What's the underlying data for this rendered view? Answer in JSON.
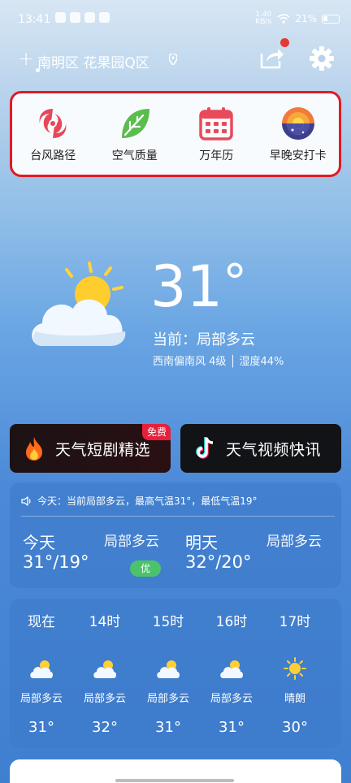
{
  "status": {
    "time": "13:41",
    "network_speed": "1.40 KB/s",
    "battery": "21%"
  },
  "location": {
    "name": "南明区 花果园Q区",
    "add_icon": "plus-icon",
    "pin_icon": "location-pin-icon"
  },
  "header_actions": {
    "share_icon": "share-icon",
    "settings_icon": "gear-icon"
  },
  "quick_actions": [
    {
      "label": "台风路径",
      "icon": "typhoon-icon"
    },
    {
      "label": "空气质量",
      "icon": "leaf-icon"
    },
    {
      "label": "万年历",
      "icon": "calendar-icon"
    },
    {
      "label": "早晚安打卡",
      "icon": "sun-moon-icon"
    }
  ],
  "current": {
    "temp": "31",
    "degree": "°",
    "condition": "当前：局部多云",
    "wind_humidity": "西南偏南风 4级 │ 湿度44%",
    "icon": "partly-cloudy-icon"
  },
  "banners": [
    {
      "label": "天气短剧精选",
      "badge": "免费",
      "icon": "flame-icon"
    },
    {
      "label": "天气视频快讯",
      "icon": "tiktok-icon"
    }
  ],
  "forecast": {
    "summary": "今天：当前局部多云，最高气温31°，最低气温19°",
    "today": {
      "name": "今天",
      "range": "31°/19°",
      "condition": "局部多云",
      "aqi": "优"
    },
    "tomorrow": {
      "name": "明天",
      "range": "32°/20°",
      "condition": "局部多云"
    }
  },
  "hourly": [
    {
      "time": "现在",
      "condition": "局部多云",
      "temp": "31°",
      "icon": "partly-cloudy-icon"
    },
    {
      "time": "14时",
      "condition": "局部多云",
      "temp": "32°",
      "icon": "partly-cloudy-icon"
    },
    {
      "time": "15时",
      "condition": "局部多云",
      "temp": "31°",
      "icon": "partly-cloudy-icon"
    },
    {
      "time": "16时",
      "condition": "局部多云",
      "temp": "31°",
      "icon": "partly-cloudy-icon"
    },
    {
      "time": "17时",
      "condition": "晴朗",
      "temp": "30°",
      "icon": "sun-icon"
    }
  ],
  "colors": {
    "highlight_border": "#e01b24",
    "aqi_good": "#4cc36b",
    "badge_red": "#e8213a"
  }
}
